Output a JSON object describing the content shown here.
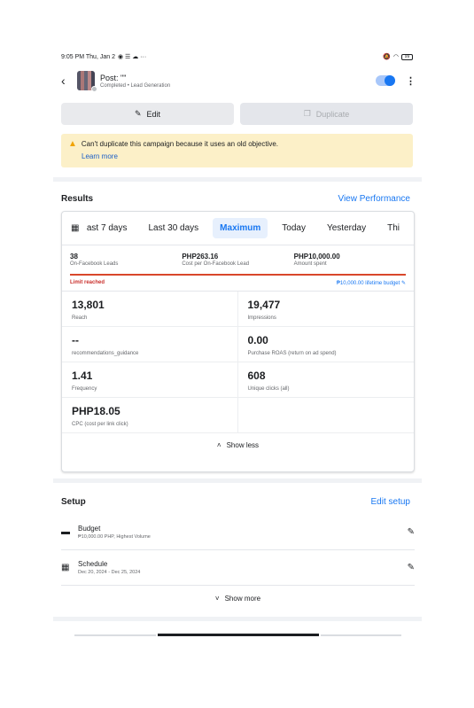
{
  "status": {
    "time": "9:05 PM Thu, Jan 2",
    "icons": "◉ ☰ ☁ ···",
    "battery": "99"
  },
  "header": {
    "title": "Post: \"\"",
    "status": "Completed",
    "objective": "• Lead Generation"
  },
  "actions": {
    "edit": "Edit",
    "duplicate": "Duplicate"
  },
  "warning": {
    "message": "Can't duplicate this campaign because it uses an old objective.",
    "link": "Learn more"
  },
  "results": {
    "title": "Results",
    "view_link": "View Performance",
    "tabs": [
      "ast 7 days",
      "Last 30 days",
      "Maximum",
      "Today",
      "Yesterday",
      "Thi"
    ],
    "active_tab": "Maximum",
    "summary": [
      {
        "value": "38",
        "label": "On-Facebook Leads"
      },
      {
        "value": "PHP263.16",
        "label": "Cost per On-Facebook Lead"
      },
      {
        "value": "PHP10,000.00",
        "label": "Amount spent"
      }
    ],
    "limit_text": "Limit reached",
    "budget_text": "₱10,000.00 lifetime budget",
    "metrics": [
      {
        "value": "13,801",
        "label": "Reach"
      },
      {
        "value": "19,477",
        "label": "Impressions"
      },
      {
        "value": "--",
        "label": "recommendations_guidance"
      },
      {
        "value": "0.00",
        "label": "Purchase ROAS (return on ad spend)"
      },
      {
        "value": "1.41",
        "label": "Frequency"
      },
      {
        "value": "608",
        "label": "Unique clicks (all)"
      },
      {
        "value": "PHP18.05",
        "label": "CPC (cost per link click)"
      },
      {
        "value": "",
        "label": ""
      }
    ],
    "show_less": "Show less"
  },
  "setup": {
    "title": "Setup",
    "edit_link": "Edit setup",
    "items": [
      {
        "title": "Budget",
        "sub": "₱10,000.00 PHP, Highest Volume"
      },
      {
        "title": "Schedule",
        "sub": "Dec 20, 2024 - Dec 25, 2024"
      }
    ],
    "show_more": "Show more"
  },
  "colors": {
    "accent": "#1877f2",
    "warning_bg": "#fcf0c8",
    "limit_red": "#d9472b"
  }
}
